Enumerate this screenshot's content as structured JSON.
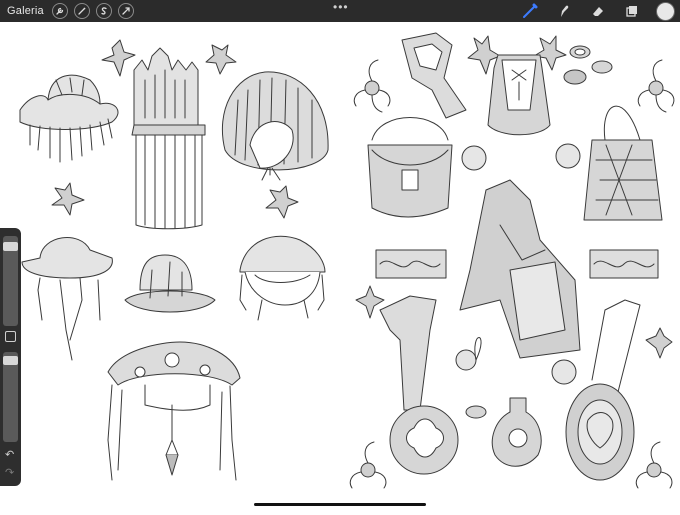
{
  "app": {
    "gallery_label": "Galeria",
    "more_label": "•••"
  },
  "toolbar_left": [
    {
      "name": "wrench-icon"
    },
    {
      "name": "magic-wand-icon"
    },
    {
      "name": "selection-s-icon"
    },
    {
      "name": "transform-arrow-icon"
    }
  ],
  "toolbar_right": [
    {
      "name": "brush-icon"
    },
    {
      "name": "smudge-icon"
    },
    {
      "name": "eraser-icon"
    },
    {
      "name": "layers-icon"
    }
  ],
  "colors": {
    "topbar": "#2b2b2b",
    "active_brush": "#3d7bfd",
    "current_color": "#e8e8e8",
    "sketch_stroke": "#3a3a3a",
    "sketch_fill": "#cfcfcf"
  },
  "sidebar": {
    "brush_size": 0.08,
    "brush_opacity": 0.05,
    "undo_label": "↶",
    "redo_label": "↷"
  }
}
